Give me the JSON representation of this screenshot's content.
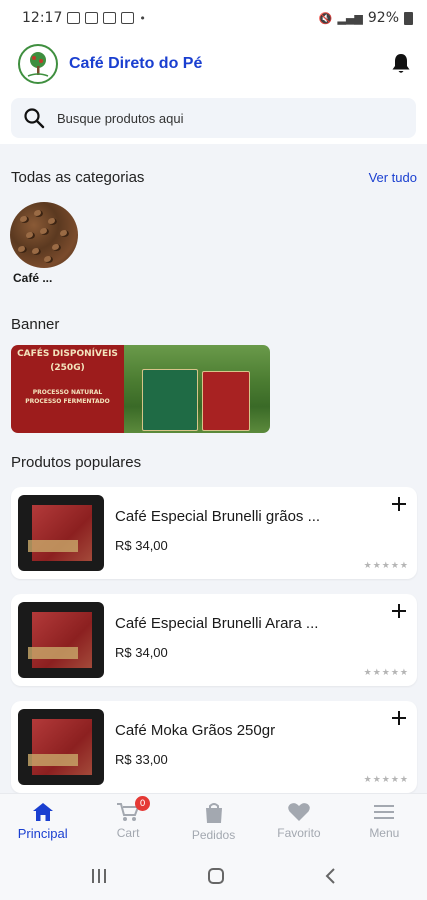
{
  "status_bar": {
    "time": "12:17",
    "battery": "92%"
  },
  "header": {
    "title": "Café Direto do Pé",
    "logo_icon": "coffee-tree-logo",
    "bell_icon": "bell-icon"
  },
  "search": {
    "placeholder": "Busque produtos aqui"
  },
  "categories": {
    "title": "Todas as categorias",
    "see_all": "Ver tudo",
    "items": [
      {
        "label": "Café ..."
      }
    ]
  },
  "banner": {
    "title": "Banner",
    "headline": "CAFÉS DISPONÍVEIS (250G)",
    "line1": "PROCESSO NATURAL",
    "line2": "PROCESSO FERMENTADO"
  },
  "popular": {
    "title": "Produtos populares",
    "products": [
      {
        "name": "Café Especial Brunelli grãos ...",
        "price": "R$ 34,00"
      },
      {
        "name": "Café Especial Brunelli Arara ...",
        "price": "R$ 34,00"
      },
      {
        "name": "Café Moka Grãos 250gr",
        "price": "R$ 33,00"
      }
    ]
  },
  "nav": {
    "items": [
      {
        "label": "Principal",
        "icon": "home-icon"
      },
      {
        "label": "Cart",
        "icon": "cart-icon",
        "badge": "0"
      },
      {
        "label": "Pedidos",
        "icon": "bag-icon"
      },
      {
        "label": "Favorito",
        "icon": "heart-icon"
      },
      {
        "label": "Menu",
        "icon": "menu-icon"
      }
    ]
  },
  "colors": {
    "accent": "#1a3fd0",
    "badge": "#e53935",
    "banner_red": "#9d1c1c"
  }
}
